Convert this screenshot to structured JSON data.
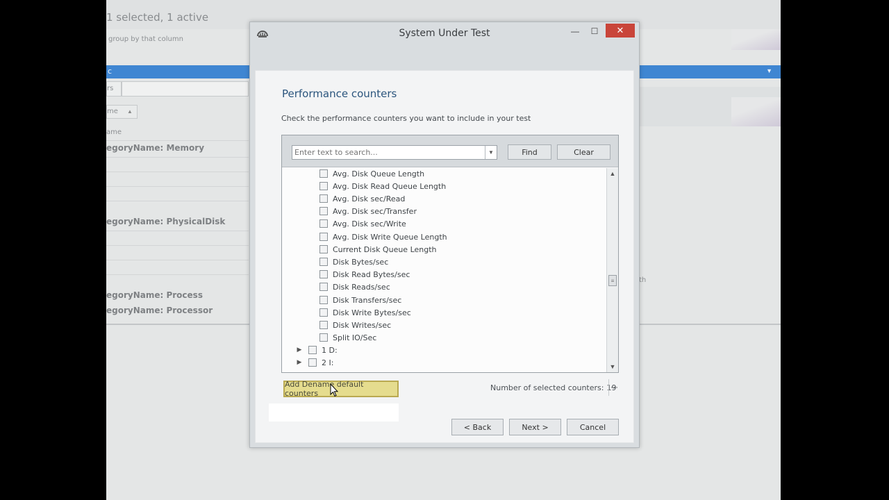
{
  "background": {
    "selection_status": "1 selected, 1 active",
    "group_hint": "group by that column",
    "tab_fragment": "rs",
    "sort_fragment": "me",
    "column_fragment": "ame",
    "categories": [
      {
        "label": "egoryName: Memory"
      },
      {
        "label": "egoryName: PhysicalDisk"
      },
      {
        "label": "egoryName: Process"
      },
      {
        "label": "egoryName: Processor"
      }
    ],
    "right_fragment": "th",
    "selected_row_fragment": "c"
  },
  "dialog": {
    "title": "System Under Test",
    "close_glyph": "✕",
    "minimize_glyph": "—",
    "maximize_glyph": "☐"
  },
  "page": {
    "heading": "Performance counters",
    "instructions": "Check the performance counters you want to include in your test"
  },
  "search": {
    "placeholder": "Enter text to search...",
    "find_label": "Find",
    "clear_label": "Clear"
  },
  "tree": {
    "counters": [
      "Avg. Disk Queue Length",
      "Avg. Disk Read Queue Length",
      "Avg. Disk sec/Read",
      "Avg. Disk sec/Transfer",
      "Avg. Disk sec/Write",
      "Avg. Disk Write Queue Length",
      "Current Disk Queue Length",
      "Disk Bytes/sec",
      "Disk Read Bytes/sec",
      "Disk Reads/sec",
      "Disk Transfers/sec",
      "Disk Write Bytes/sec",
      "Disk Writes/sec",
      "Split IO/Sec"
    ],
    "instances": [
      "1 D:",
      "2 I:"
    ]
  },
  "footer": {
    "add_defaults_label": "Add Dename default counters",
    "selected_counters_label": "Number of selected counters:",
    "selected_counters_value": "19",
    "more_label": "···",
    "back_label": "< Back",
    "next_label": "Next >",
    "cancel_label": "Cancel"
  },
  "colors": {
    "heading": "#2b557d",
    "close_button": "#c9453a",
    "highlight_button": "#e5dc8e",
    "selection_bar": "#3f86d2"
  }
}
